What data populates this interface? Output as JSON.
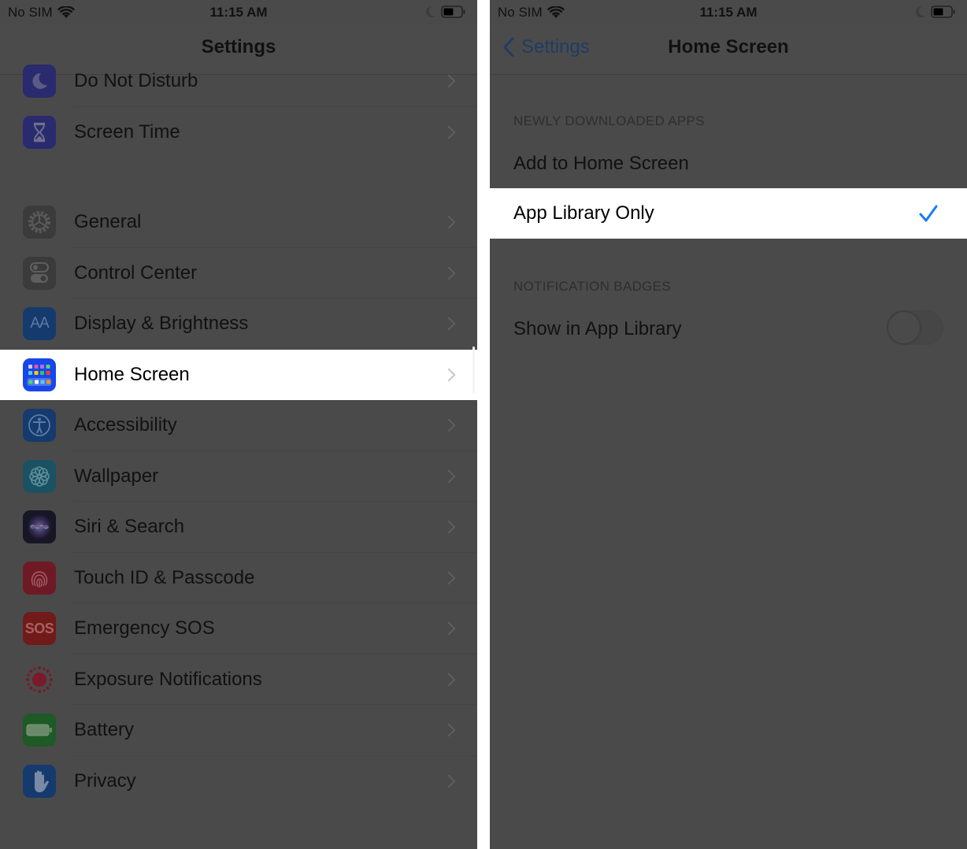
{
  "left": {
    "status": {
      "carrier": "No SIM",
      "time": "11:15 AM"
    },
    "nav_title": "Settings",
    "groups": [
      {
        "items": [
          {
            "label": "Do Not Disturb",
            "icon": "moon-icon",
            "color": "#2a2a6e"
          },
          {
            "label": "Screen Time",
            "icon": "hourglass-icon",
            "color": "#2a2a6e"
          }
        ]
      },
      {
        "items": [
          {
            "label": "General",
            "icon": "gear-icon",
            "color": "#3b3b3b"
          },
          {
            "label": "Control Center",
            "icon": "toggles-icon",
            "color": "#3b3b3b"
          },
          {
            "label": "Display & Brightness",
            "icon": "text-size-icon",
            "color": "#153a6e"
          },
          {
            "label": "Home Screen",
            "icon": "home-grid-icon",
            "color": "#1747e8",
            "highlighted": true
          },
          {
            "label": "Accessibility",
            "icon": "accessibility-icon",
            "color": "#153a6e"
          },
          {
            "label": "Wallpaper",
            "icon": "flower-icon",
            "color": "#1b5263"
          },
          {
            "label": "Siri & Search",
            "icon": "siri-icon",
            "color": "#161624"
          },
          {
            "label": "Touch ID & Passcode",
            "icon": "fingerprint-icon",
            "color": "#6e1a24"
          },
          {
            "label": "Emergency SOS",
            "icon": "sos-icon",
            "color": "#701a1a",
            "icon_text": "SOS"
          },
          {
            "label": "Exposure Notifications",
            "icon": "exposure-icon",
            "color": "#4a4a4a"
          },
          {
            "label": "Battery",
            "icon": "battery-icon",
            "color": "#1d5a25"
          },
          {
            "label": "Privacy",
            "icon": "hand-icon",
            "color": "#153a6e"
          }
        ]
      }
    ]
  },
  "right": {
    "status": {
      "carrier": "No SIM",
      "time": "11:15 AM"
    },
    "back_label": "Settings",
    "nav_title": "Home Screen",
    "sections": [
      {
        "header": "NEWLY DOWNLOADED APPS",
        "options": [
          {
            "label": "Add to Home Screen",
            "selected": false
          },
          {
            "label": "App Library Only",
            "selected": true
          }
        ]
      },
      {
        "header": "NOTIFICATION BADGES",
        "toggles": [
          {
            "label": "Show in App Library",
            "on": false
          }
        ]
      }
    ]
  },
  "colors": {
    "accent": "#1a7cf5",
    "dim_background": "#4a4a4a",
    "highlight": "#ffffff"
  }
}
